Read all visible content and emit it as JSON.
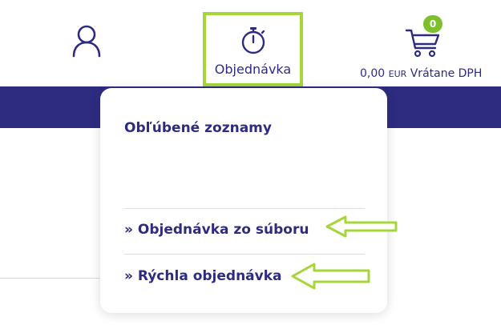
{
  "header": {
    "order_label": "Objednávka",
    "cart_count": "0",
    "cart_price": "0,00",
    "cart_currency": "EUR",
    "cart_vat": "Vrátane DPH"
  },
  "dropdown": {
    "heading": "Obľúbené zoznamy",
    "links": [
      {
        "label": "» Objednávka zo súboru"
      },
      {
        "label": "» Rýchla objednávka"
      }
    ]
  },
  "colors": {
    "brand": "#2e2c80",
    "highlight": "#a6d63a",
    "badge": "#7fbf2c"
  },
  "icons": [
    "user-icon",
    "stopwatch-icon",
    "cart-icon",
    "arrow-left-icon"
  ]
}
